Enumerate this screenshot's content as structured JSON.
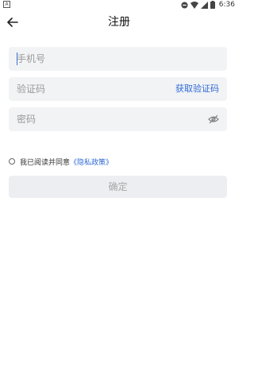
{
  "status_bar": {
    "time": "6:36",
    "left_icon": "notification-a-icon",
    "right_icons": [
      "dnd-icon",
      "wifi-icon",
      "signal-icon",
      "battery-icon"
    ]
  },
  "header": {
    "back_icon": "arrow-left-icon",
    "title": "注册"
  },
  "form": {
    "phone_placeholder": "手机号",
    "code_placeholder": "验证码",
    "get_code_label": "获取验证码",
    "password_placeholder": "密码",
    "eye_icon": "eye-off-icon"
  },
  "agreement": {
    "prefix": "我已阅读并同意",
    "policy_link": "《隐私政策》"
  },
  "confirm_label": "确定",
  "colors": {
    "accent": "#2f6bd6",
    "field_bg": "#f2f3f5",
    "disabled_btn": "#eceef1"
  }
}
